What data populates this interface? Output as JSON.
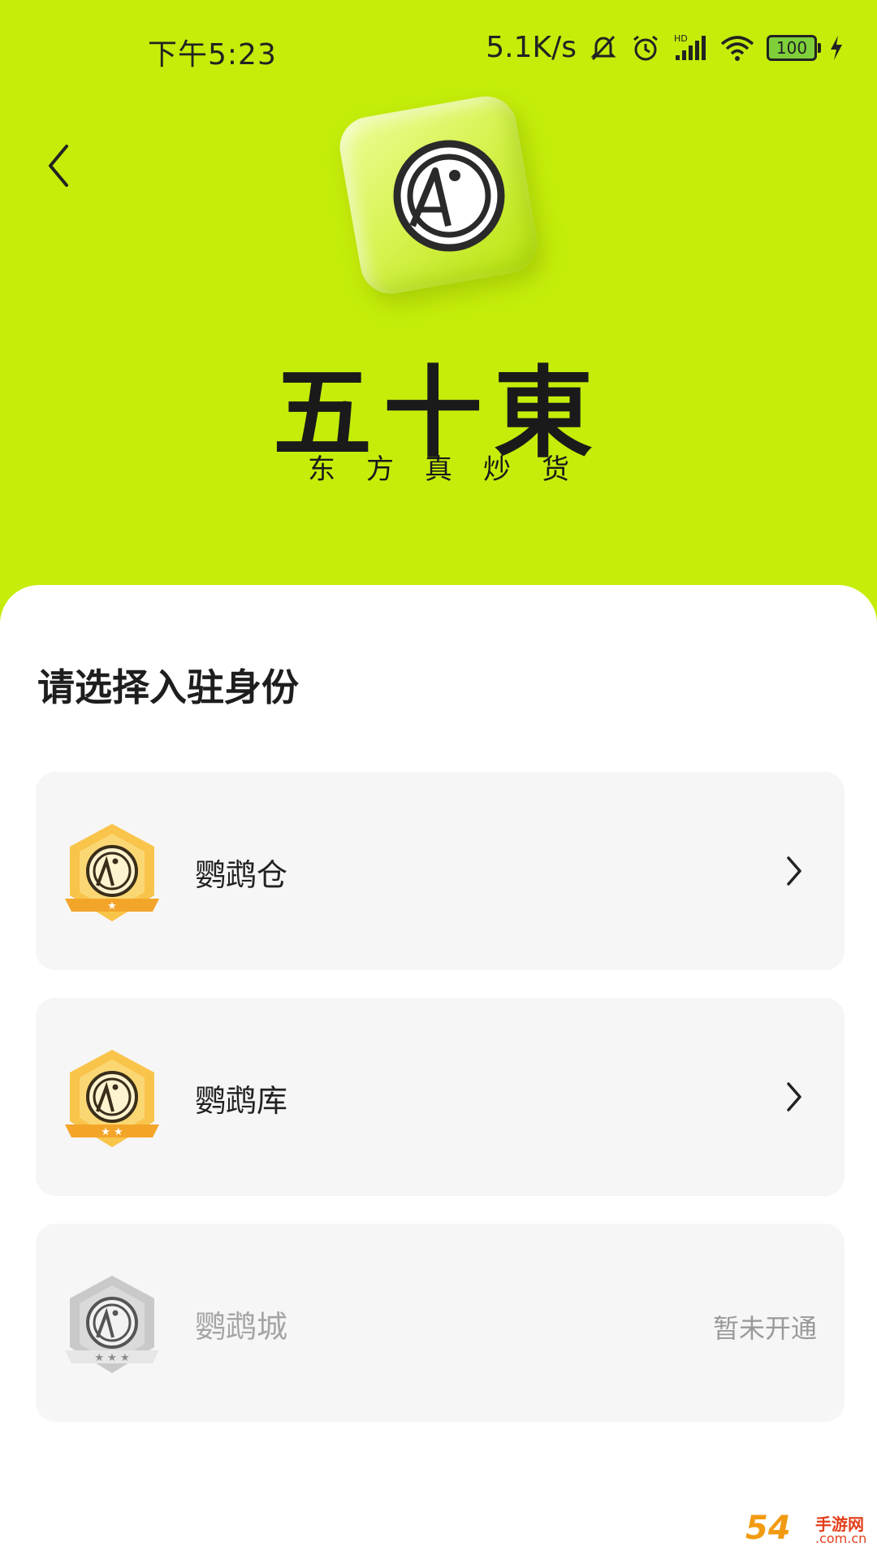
{
  "status_bar": {
    "time": "下午5:23",
    "net_speed": "5.1K/s",
    "battery_level": "100",
    "icons": [
      "mute-bell-icon",
      "alarm-icon",
      "hd-signal-icon",
      "wifi-icon",
      "battery-icon",
      "charging-icon"
    ]
  },
  "header": {
    "back_icon": "chevron-left-icon",
    "logo_icon": "parrot-logo-icon",
    "brand_name": "五十東",
    "slogan": "东方真炒货",
    "background_color": "#c4ed0a"
  },
  "selection": {
    "title": "请选择入驻身份",
    "options": [
      {
        "label": "鹦鹉仓",
        "stars": 1,
        "enabled": true,
        "trailing_icon": "chevron-right-icon"
      },
      {
        "label": "鹦鹉库",
        "stars": 2,
        "enabled": true,
        "trailing_icon": "chevron-right-icon"
      },
      {
        "label": "鹦鹉城",
        "stars": 3,
        "enabled": false,
        "status": "暂未开通"
      }
    ]
  },
  "watermark": {
    "main": "54",
    "side": "手游网",
    "url": ".com.cn"
  }
}
